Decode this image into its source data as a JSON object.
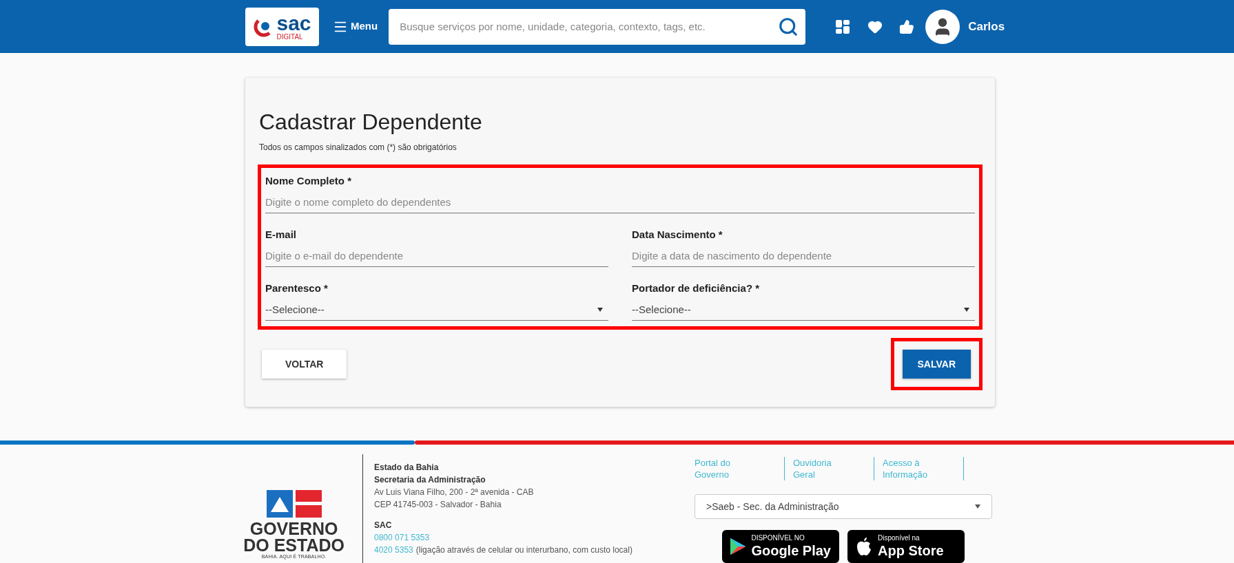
{
  "header": {
    "logo": {
      "main": "sac",
      "sub": "DIGITAL"
    },
    "menu": "Menu",
    "search": {
      "placeholder": "Busque serviços por nome, unidade, categoria, contexto, tags, etc."
    },
    "user": "Carlos"
  },
  "form": {
    "title": "Cadastrar Dependente",
    "note": "Todos os campos sinalizados com (*) são obrigatórios",
    "highlighted": true,
    "rows": [
      [
        {
          "kind": "text",
          "label": "Nome Completo *",
          "placeholder": "Digite o nome completo do dependentes"
        }
      ],
      [
        {
          "kind": "text",
          "label": "E-mail",
          "placeholder": "Digite o e-mail do dependente"
        },
        {
          "kind": "text",
          "label": "Data Nascimento *",
          "placeholder": "Digite a data de nascimento do dependente"
        }
      ],
      [
        {
          "kind": "select",
          "label": "Parentesco *",
          "value": "--Selecione--"
        },
        {
          "kind": "select",
          "label": "Portador de deficiência? *",
          "value": "--Selecione--"
        }
      ]
    ],
    "back": {
      "label": "VOLTAR",
      "highlighted": false
    },
    "save": {
      "label": "SALVAR",
      "highlighted": true
    }
  },
  "footer": {
    "logo": {
      "line1": "GOVERNO",
      "line2": "DO ESTADO",
      "tagline": "BAHIA. AQUI É TRABALHO."
    },
    "address": [
      {
        "kind": "bold",
        "text": "Estado da Bahia"
      },
      {
        "kind": "bold",
        "text": "Secretaria da Administração"
      },
      {
        "kind": "plain",
        "text": "Av Luis Viana Filho, 200 - 2ª avenida - CAB"
      },
      {
        "kind": "plain",
        "text": "CEP 41745-003 - Salvador - Bahia"
      }
    ],
    "sac": {
      "title": "SAC",
      "phone1": "0800 071 5353",
      "phone2": "4020 5353",
      "phone2_note": "(ligação através de celular ou interurbano, com custo local)"
    },
    "links": [
      {
        "line1": "Portal do",
        "line2": "Governo"
      },
      {
        "line1": "Ouvidoria",
        "line2": "Geral"
      },
      {
        "line1": "Acesso à",
        "line2": "Informação"
      }
    ],
    "select": {
      "value": ">Saeb - Sec. da Administração"
    },
    "stores": [
      {
        "kind": "google",
        "small": "DISPONÍVEL NO",
        "big": "Google Play"
      },
      {
        "kind": "apple",
        "small": "Disponível na",
        "big": "App Store"
      }
    ]
  }
}
